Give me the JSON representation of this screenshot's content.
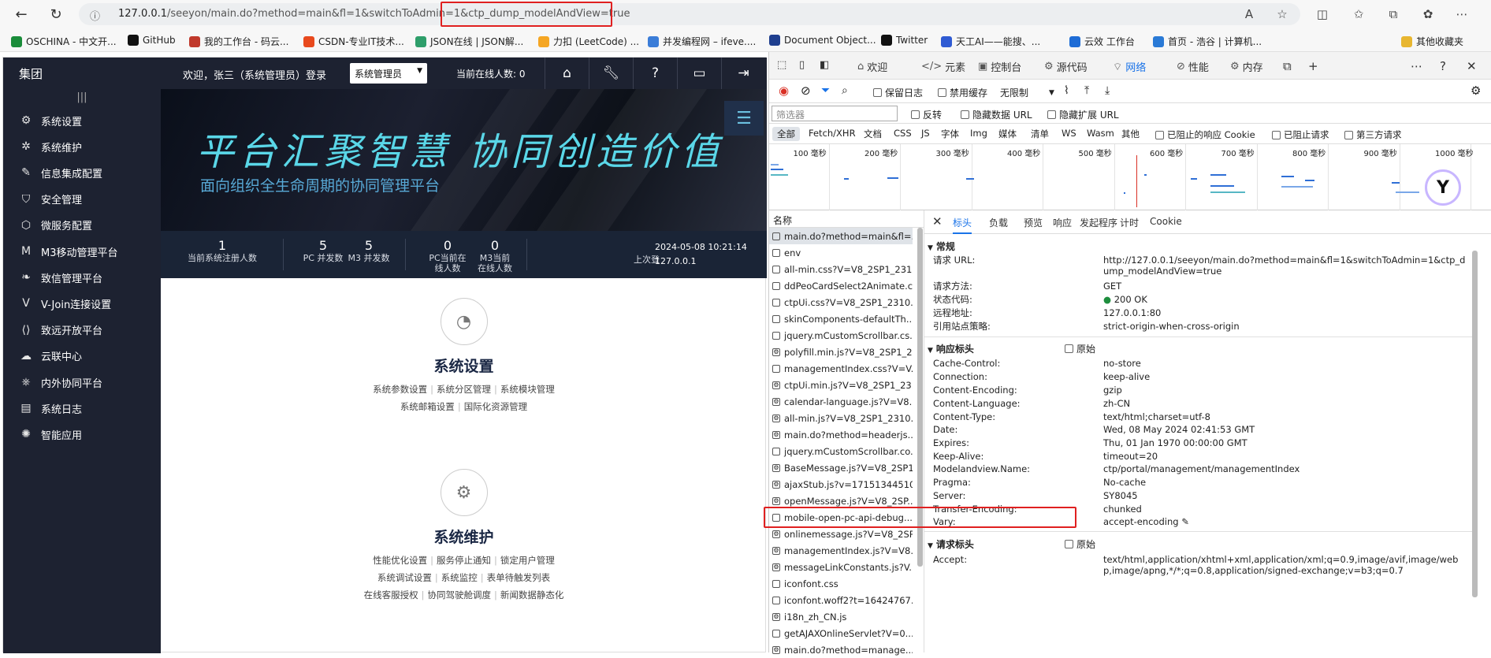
{
  "browser": {
    "url": "127.0.0.1/seeyon/main.do?method=main&fl=1&switchToAdmin=1&ctp_dump_modelAndView=true",
    "url_host": "127.0.0.1",
    "url_rest": "/seeyon/main.do?method=main&fl=1&switchToAdmin=1&ctp_dump_modelAndView=true",
    "bookmarks": [
      "OSCHINA - 中文开...",
      "GitHub",
      "我的工作台 - 码云...",
      "CSDN-专业IT技术...",
      "JSON在线 | JSON解...",
      "力扣 (LeetCode) ...",
      "并发编程网 – ifeve....",
      "Document Object...",
      "Twitter",
      "天工AI——能搜、...",
      "云效 工作台",
      "首页 - 浩谷 | 计算机...",
      "其他收藏夹"
    ],
    "bookmark_colors": [
      "#1a8c3a",
      "#111111",
      "#c0392b",
      "#e8491d",
      "#2e9e6a",
      "#f5a623",
      "#3b7dd8",
      "#1f3f8f",
      "#111111",
      "#2f5bd3",
      "#1e6cd6",
      "#2a7ad6",
      "#e8b630"
    ]
  },
  "app": {
    "logo": "集团",
    "welcome": "欢迎，张三（系统管理员）登录",
    "role": "系统管理员",
    "online": "当前在线人数: 0",
    "header_icons": [
      "home-icon",
      "wrench-icon",
      "help-icon",
      "monitor-icon",
      "logout-icon"
    ],
    "sidebar": [
      {
        "icon": "gear-icon",
        "label": "系统设置"
      },
      {
        "icon": "cog-icon",
        "label": "系统维护"
      },
      {
        "icon": "pen-icon",
        "label": "信息集成配置"
      },
      {
        "icon": "shield-icon",
        "label": "安全管理"
      },
      {
        "icon": "hexagon-icon",
        "label": "微服务配置"
      },
      {
        "icon": "m-icon",
        "label": "M3移动管理平台"
      },
      {
        "icon": "leaf-icon",
        "label": "致信管理平台"
      },
      {
        "icon": "v-icon",
        "label": "V-Join连接设置"
      },
      {
        "icon": "code-icon",
        "label": "致远开放平台"
      },
      {
        "icon": "cloud-icon",
        "label": "云联中心"
      },
      {
        "icon": "network-icon",
        "label": "内外协同平台"
      },
      {
        "icon": "log-icon",
        "label": "系统日志"
      },
      {
        "icon": "bulb-icon",
        "label": "智能应用"
      }
    ],
    "banner_title": "平台汇聚智慧  协同创造价值",
    "banner_sub": "面向组织全生命周期的协同管理平台",
    "stats": [
      {
        "num": "1",
        "label": "当前系统注册人数"
      },
      {
        "num": "5",
        "label": "PC 并发数"
      },
      {
        "num": "5",
        "label": "M3 并发数"
      },
      {
        "num": "0",
        "label": "PC当前在线人数"
      },
      {
        "num": "0",
        "label": "M3当前在线人数"
      }
    ],
    "last_login_label": "上次登",
    "last_login_time": "2024-05-08 10:21:14",
    "last_login_ip": "127.0.0.1",
    "cards": [
      {
        "title": "系统设置",
        "lines": [
          [
            "系统参数设置",
            "系统分区管理",
            "系统模块管理"
          ],
          [
            "系统邮箱设置",
            "国际化资源管理"
          ]
        ]
      },
      {
        "title": "系统维护",
        "lines": [
          [
            "性能优化设置",
            "服务停止通知",
            "锁定用户管理"
          ],
          [
            "系统调试设置",
            "系统监控",
            "表单待触发列表"
          ],
          [
            "在线客服授权",
            "协同驾驶舱调度",
            "新闻数据静态化"
          ]
        ]
      }
    ]
  },
  "devtools": {
    "tabs": [
      "欢迎",
      "元素",
      "控制台",
      "源代码",
      "网络",
      "性能",
      "内存"
    ],
    "active_tab": "网络",
    "toolbar": {
      "preserve_log": "保留日志",
      "disable_cache": "禁用缓存",
      "throttle": "无限制"
    },
    "filter": {
      "placeholder": "筛选器",
      "invert": "反转",
      "hide_data_url": "隐藏数据 URL",
      "hide_ext_url": "隐藏扩展 URL"
    },
    "types": [
      "全部",
      "Fetch/XHR",
      "文档",
      "CSS",
      "JS",
      "字体",
      "Img",
      "媒体",
      "清单",
      "WS",
      "Wasm",
      "其他"
    ],
    "type_checks": [
      "已阻止的响应 Cookie",
      "已阻止请求",
      "第三方请求"
    ],
    "timeline_ticks": [
      "100 毫秒",
      "200 毫秒",
      "300 毫秒",
      "400 毫秒",
      "500 毫秒",
      "600 毫秒",
      "700 毫秒",
      "800 毫秒",
      "900 毫秒",
      "1000 毫秒"
    ],
    "name_header": "名称",
    "requests": [
      "main.do?method=main&fl=...",
      "env",
      "all-min.css?V=V8_2SP1_231...",
      "ddPeoCardSelect2Animate.c...",
      "ctpUi.css?V=V8_2SP1_2310...",
      "skinComponents-defaultTh...",
      "jquery.mCustomScrollbar.cs...",
      "polyfill.min.js?V=V8_2SP1_2...",
      "managementIndex.css?V=V...",
      "ctpUi.min.js?V=V8_2SP1_23...",
      "calendar-language.js?V=V8...",
      "all-min.js?V=V8_2SP1_2310...",
      "main.do?method=headerjs...",
      "jquery.mCustomScrollbar.co...",
      "BaseMessage.js?V=V8_2SP1...",
      "ajaxStub.js?v=17151344510...",
      "openMessage.js?V=V8_2SP...",
      "mobile-open-pc-api-debug...",
      "onlinemessage.js?V=V8_2SP...",
      "managementIndex.js?V=V8...",
      "messageLinkConstants.js?V...",
      "iconfont.css",
      "iconfont.woff2?t=16424767...",
      "i18n_zh_CN.js",
      "getAJAXOnlineServlet?V=0...",
      "main.do?method=manage..."
    ],
    "detail_tabs": [
      "标头",
      "负载",
      "预览",
      "响应",
      "发起程序",
      "计时",
      "Cookie"
    ],
    "general_title": "常规",
    "general": [
      {
        "k": "请求 URL:",
        "v": "http://127.0.0.1/seeyon/main.do?method=main&fl=1&switchToAdmin=1&ctp_dump_modelAndView=true"
      },
      {
        "k": "请求方法:",
        "v": "GET"
      },
      {
        "k": "状态代码:",
        "v": "200 OK"
      },
      {
        "k": "远程地址:",
        "v": "127.0.0.1:80"
      },
      {
        "k": "引用站点策略:",
        "v": "strict-origin-when-cross-origin"
      }
    ],
    "resp_title": "响应标头",
    "raw_label": "原始",
    "response_headers": [
      {
        "k": "Cache-Control:",
        "v": "no-store"
      },
      {
        "k": "Connection:",
        "v": "keep-alive"
      },
      {
        "k": "Content-Encoding:",
        "v": "gzip"
      },
      {
        "k": "Content-Language:",
        "v": "zh-CN"
      },
      {
        "k": "Content-Type:",
        "v": "text/html;charset=utf-8"
      },
      {
        "k": "Date:",
        "v": "Wed, 08 May 2024 02:41:53 GMT"
      },
      {
        "k": "Expires:",
        "v": "Thu, 01 Jan 1970 00:00:00 GMT"
      },
      {
        "k": "Keep-Alive:",
        "v": "timeout=20"
      },
      {
        "k": "Modelandview.Name:",
        "v": "ctp/portal/management/managementIndex"
      },
      {
        "k": "Pragma:",
        "v": "No-cache"
      },
      {
        "k": "Server:",
        "v": "SY8045"
      },
      {
        "k": "Transfer-Encoding:",
        "v": "chunked"
      },
      {
        "k": "Vary:",
        "v": "accept-encoding"
      }
    ],
    "req_title": "请求标头",
    "request_headers": [
      {
        "k": "Accept:",
        "v": "text/html,application/xhtml+xml,application/xml;q=0.9,image/avif,image/webp,image/apng,*/*;q=0.8,application/signed-exchange;v=b3;q=0.7"
      }
    ]
  }
}
